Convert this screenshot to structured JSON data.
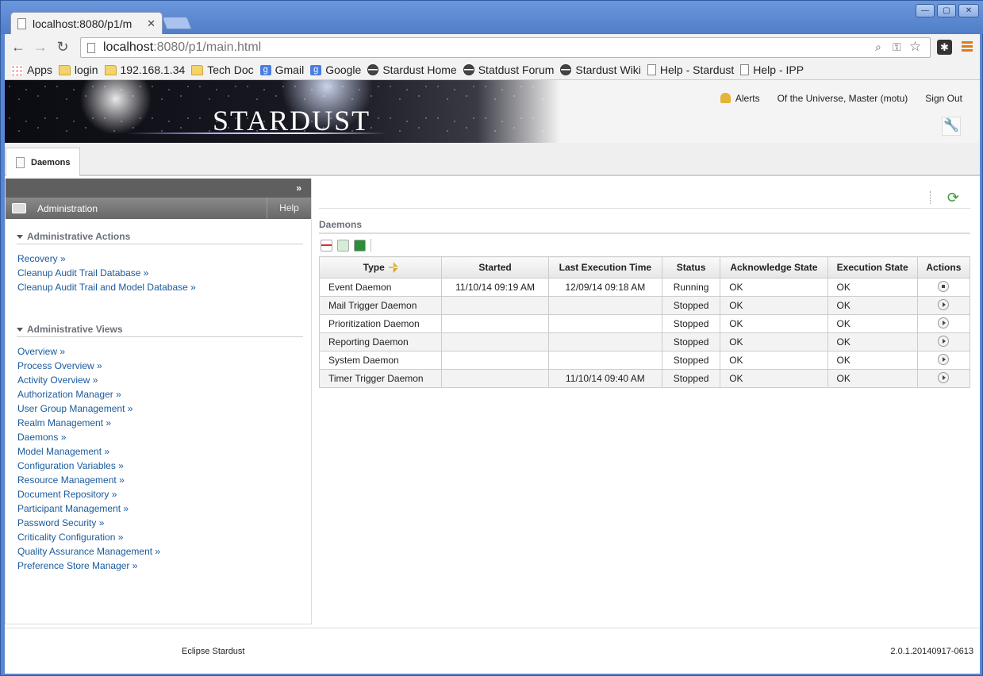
{
  "browser": {
    "tab_title": "localhost:8080/p1/m",
    "url_host": "localhost",
    "url_rest": ":8080/p1/main.html",
    "bookmarks": [
      {
        "label": "Apps",
        "icon": "apps-grid-icon"
      },
      {
        "label": "login",
        "icon": "folder-icon"
      },
      {
        "label": "192.168.1.34",
        "icon": "folder-icon"
      },
      {
        "label": "Tech Doc",
        "icon": "folder-icon"
      },
      {
        "label": "Gmail",
        "icon": "google-icon"
      },
      {
        "label": "Google",
        "icon": "google-icon"
      },
      {
        "label": "Stardust Home",
        "icon": "stardust-icon"
      },
      {
        "label": "Statdust Forum",
        "icon": "stardust-icon"
      },
      {
        "label": "Stardust Wiki",
        "icon": "stardust-icon"
      },
      {
        "label": "Help - Stardust",
        "icon": "page-icon"
      },
      {
        "label": "Help - IPP",
        "icon": "page-icon"
      }
    ]
  },
  "header": {
    "logo": "STARDUST",
    "alerts": "Alerts",
    "user": "Of the Universe, Master (motu)",
    "signout": "Sign Out"
  },
  "page_tab": "Daemons",
  "sidebar": {
    "collapse": "»",
    "title": "Administration",
    "help": "Help",
    "actions_title": "Administrative Actions",
    "actions": [
      "Recovery »",
      "Cleanup Audit Trail Database »",
      "Cleanup Audit Trail and Model Database »"
    ],
    "views_title": "Administrative Views",
    "views": [
      "Overview »",
      "Process Overview »",
      "Activity Overview »",
      "Authorization Manager »",
      "User Group Management »",
      "Realm Management »",
      "Daemons »",
      "Model Management »",
      "Configuration Variables »",
      "Resource Management »",
      "Document Repository »",
      "Participant Management »",
      "Password Security »",
      "Criticality Configuration »",
      "Quality Assurance Management »",
      "Preference Store Manager »"
    ]
  },
  "main": {
    "title": "Daemons",
    "columns": [
      "Type",
      "Started",
      "Last Execution Time",
      "Status",
      "Acknowledge State",
      "Execution State",
      "Actions"
    ],
    "rows": [
      {
        "type": "Event Daemon",
        "started": "11/10/14 09:19 AM",
        "last": "12/09/14 09:18 AM",
        "status": "Running",
        "ack": "OK",
        "exec": "OK",
        "action": "stop-icon"
      },
      {
        "type": "Mail Trigger Daemon",
        "started": "",
        "last": "",
        "status": "Stopped",
        "ack": "OK",
        "exec": "OK",
        "action": "start-icon"
      },
      {
        "type": "Prioritization Daemon",
        "started": "",
        "last": "",
        "status": "Stopped",
        "ack": "OK",
        "exec": "OK",
        "action": "start-icon"
      },
      {
        "type": "Reporting Daemon",
        "started": "",
        "last": "",
        "status": "Stopped",
        "ack": "OK",
        "exec": "OK",
        "action": "start-icon"
      },
      {
        "type": "System Daemon",
        "started": "",
        "last": "",
        "status": "Stopped",
        "ack": "OK",
        "exec": "OK",
        "action": "start-icon"
      },
      {
        "type": "Timer Trigger Daemon",
        "started": "",
        "last": "11/10/14 09:40 AM",
        "status": "Stopped",
        "ack": "OK",
        "exec": "OK",
        "action": "start-icon"
      }
    ]
  },
  "footer": {
    "left": "Eclipse Stardust",
    "right": "2.0.1.20140917-0613"
  }
}
